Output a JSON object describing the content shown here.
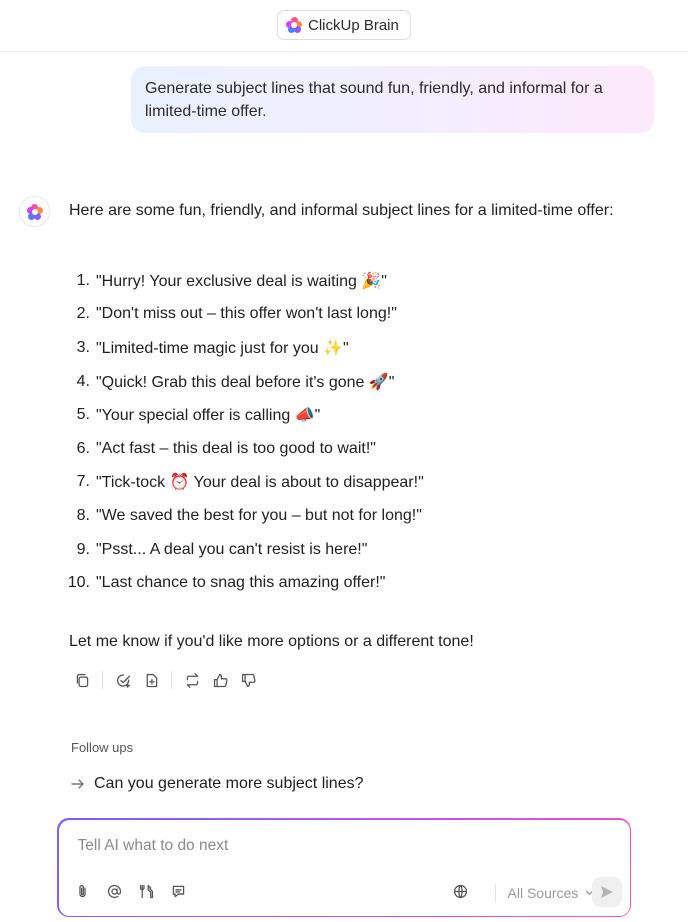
{
  "header": {
    "app_title": "ClickUp Brain",
    "logo_icon": "clickup-brain-logo-icon"
  },
  "user_message": {
    "text": "Generate subject lines that sound fun, friendly, and informal for a limited-time offer."
  },
  "ai_response": {
    "intro": "Here are some fun, friendly, and informal subject lines for a limited-time offer:",
    "items": [
      {
        "num": "1.",
        "text": "\"Hurry! Your exclusive deal is waiting 🎉\""
      },
      {
        "num": "2.",
        "text": "\"Don't miss out – this offer won't last long!\""
      },
      {
        "num": "3.",
        "text": "\"Limited-time magic just for you ✨\""
      },
      {
        "num": "4.",
        "text": "\"Quick! Grab this deal before it's gone 🚀\""
      },
      {
        "num": "5.",
        "text": "\"Your special offer is calling 📣\""
      },
      {
        "num": "6.",
        "text": "\"Act fast – this deal is too good to wait!\""
      },
      {
        "num": "7.",
        "text": "\"Tick-tock ⏰ Your deal is about to disappear!\""
      },
      {
        "num": "8.",
        "text": "\"We saved the best for you – but not for long!\""
      },
      {
        "num": "9.",
        "text": "\"Psst... A deal you can't resist is here!\""
      },
      {
        "num": "10.",
        "text": "\"Last chance to snag this amazing offer!\""
      }
    ],
    "outro": "Let me know if you'd like more options or a different tone!",
    "action_icons": [
      "copy-icon",
      "create-task-icon",
      "add-doc-icon",
      "regenerate-icon",
      "thumbs-up-icon",
      "thumbs-down-icon"
    ]
  },
  "followups": {
    "label": "Follow ups",
    "items": [
      {
        "text": "Can you generate more subject lines?"
      }
    ]
  },
  "composer": {
    "placeholder": "Tell AI what to do next",
    "sources_label": "All Sources",
    "tool_icons": [
      "attach-icon",
      "mention-icon",
      "tools-icon",
      "prompt-template-icon",
      "globe-icon"
    ],
    "gradient_colors": [
      "#7b5cff",
      "#b455ff",
      "#ff4fb0"
    ]
  }
}
